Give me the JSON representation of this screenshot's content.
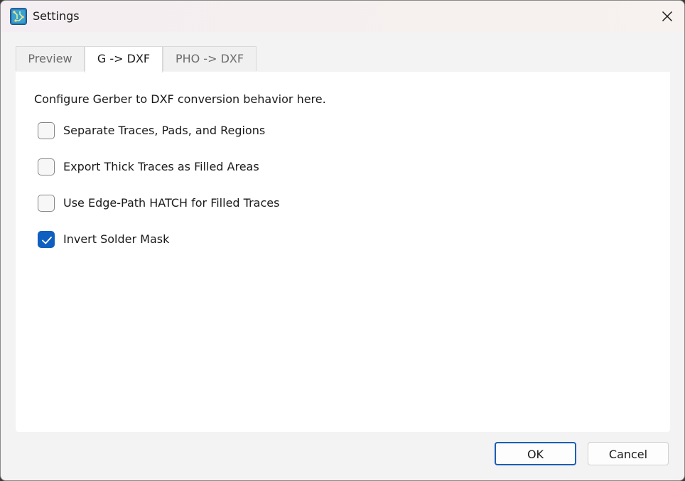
{
  "window": {
    "title": "Settings",
    "icon": "app-pcb-icon",
    "close_icon": "close-icon"
  },
  "tabs": [
    {
      "label": "Preview",
      "active": false
    },
    {
      "label": "G -> DXF",
      "active": true
    },
    {
      "label": "PHO -> DXF",
      "active": false
    }
  ],
  "panel": {
    "intro": "Configure Gerber to DXF conversion behavior here.",
    "options": [
      {
        "label": "Separate Traces, Pads, and Regions",
        "checked": false
      },
      {
        "label": "Export Thick Traces as Filled Areas",
        "checked": false
      },
      {
        "label": "Use Edge-Path HATCH for Filled Traces",
        "checked": false
      },
      {
        "label": "Invert Solder Mask",
        "checked": true
      }
    ]
  },
  "buttons": {
    "ok_label": "OK",
    "cancel_label": "Cancel"
  },
  "colors": {
    "accent": "#0f5fc0",
    "default_button_border": "#1a5fb4"
  }
}
